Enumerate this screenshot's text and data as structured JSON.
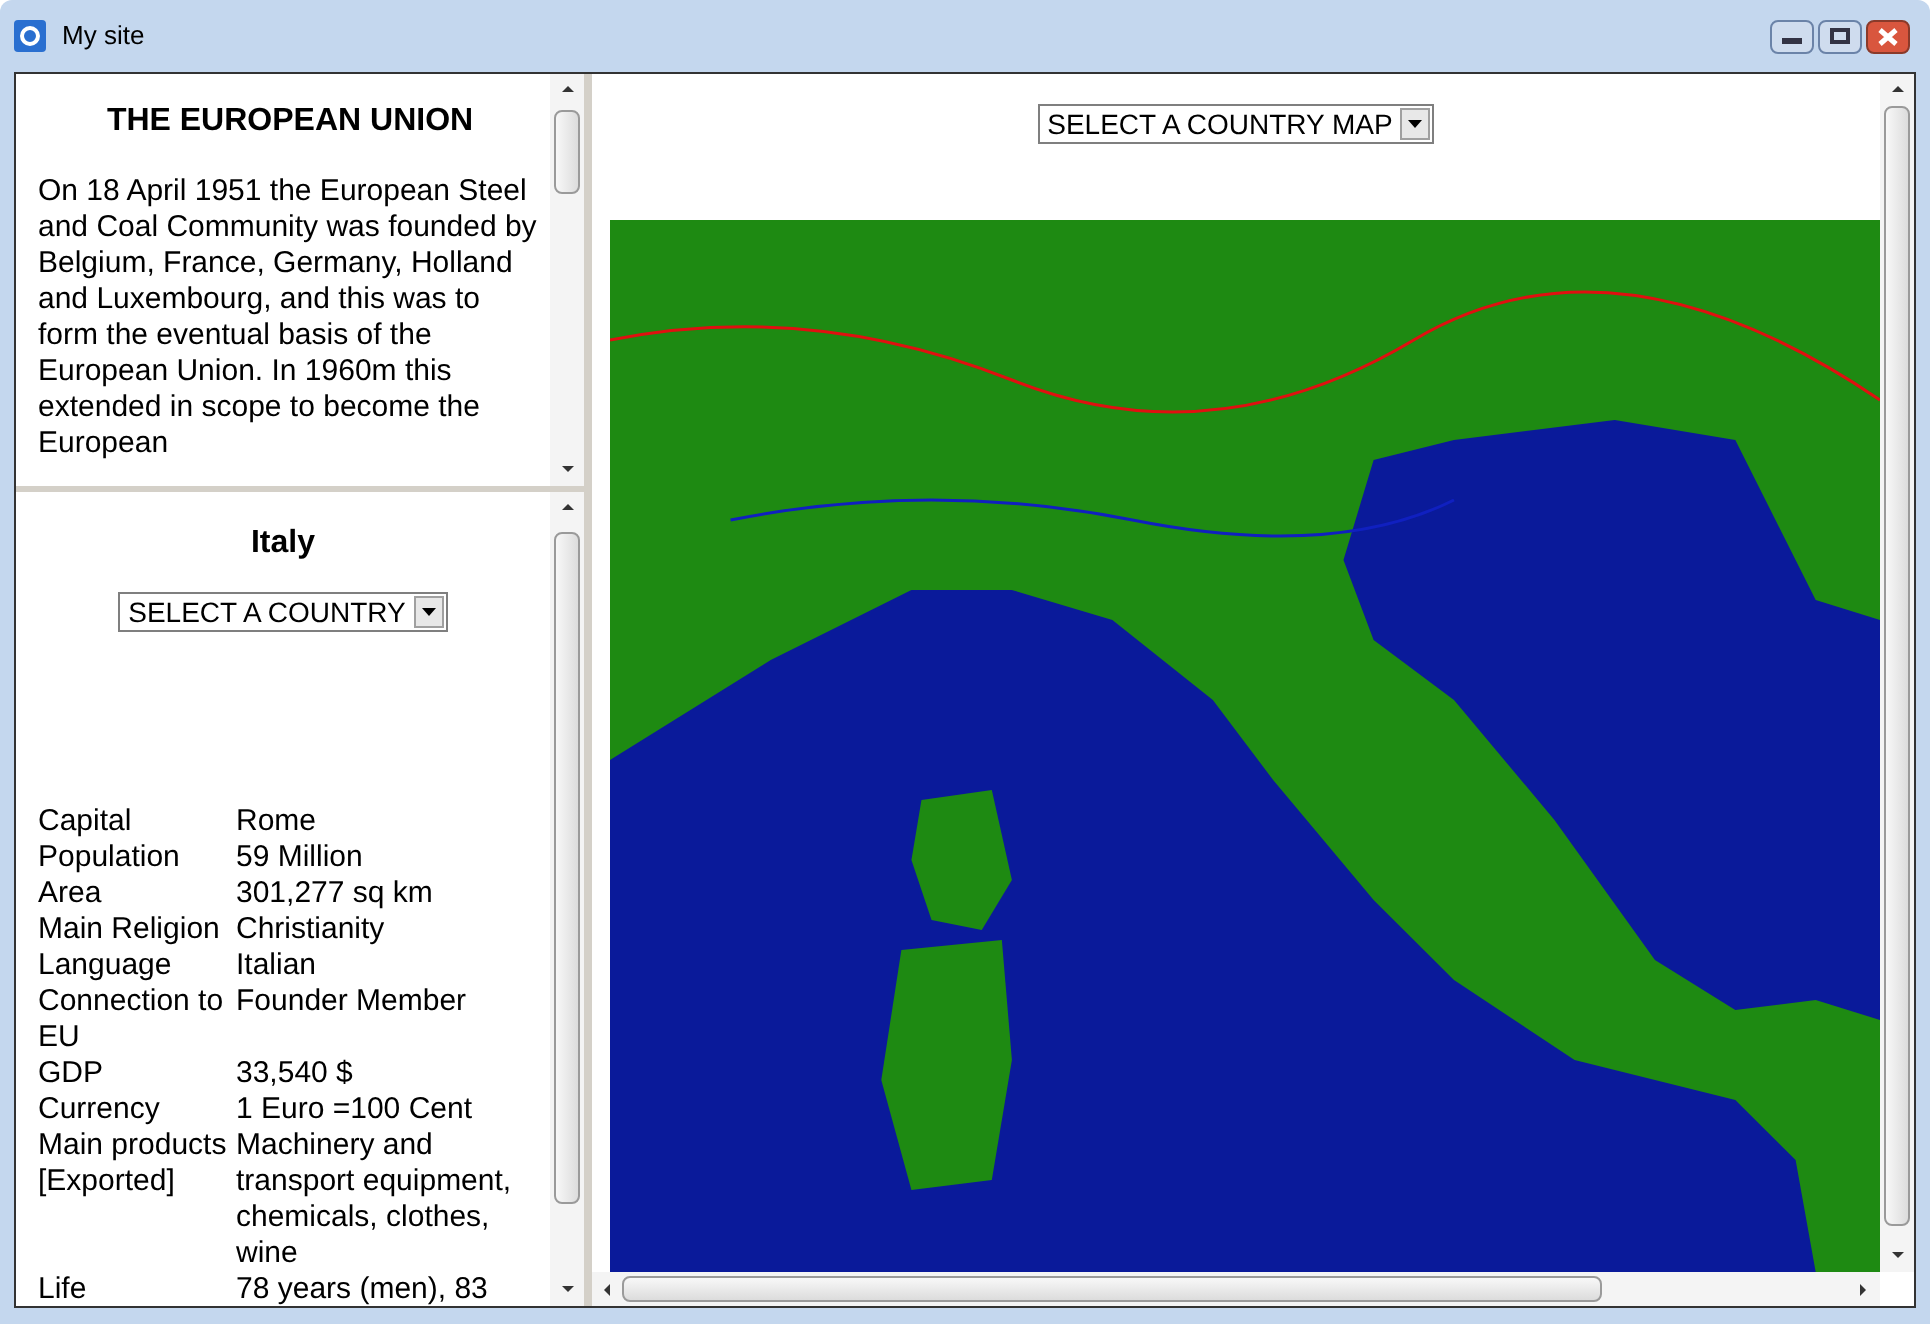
{
  "window": {
    "title": "My site"
  },
  "intro": {
    "heading": "THE EUROPEAN UNION",
    "paragraph": "On 18 April 1951 the European Steel and Coal Community was founded by Belgium, France, Germany, Holland and Luxembourg, and this was to form the eventual basis of the European Union. In 1960m this extended in scope to become the European"
  },
  "country": {
    "name": "Italy",
    "select": "SELECT A COUNTRY",
    "facts": [
      {
        "label": "Capital",
        "value": "Rome"
      },
      {
        "label": "Population",
        "value": "59 Million"
      },
      {
        "label": "Area",
        "value": "301,277 sq km"
      },
      {
        "label": "Main Religion",
        "value": "Christianity"
      },
      {
        "label": "Language",
        "value": "Italian"
      },
      {
        "label": "Connection to EU",
        "value": "Founder Member"
      },
      {
        "label": "GDP",
        "value": "33,540 $"
      },
      {
        "label": "Currency",
        "value": "1 Euro =100 Cent"
      },
      {
        "label": "Main products [Exported]",
        "value": "Machinery and transport equipment, chemicals, clothes, wine"
      },
      {
        "label": "Life",
        "value": "78 years (men), 83"
      }
    ]
  },
  "map": {
    "select": "SELECT A COUNTRY MAP"
  }
}
